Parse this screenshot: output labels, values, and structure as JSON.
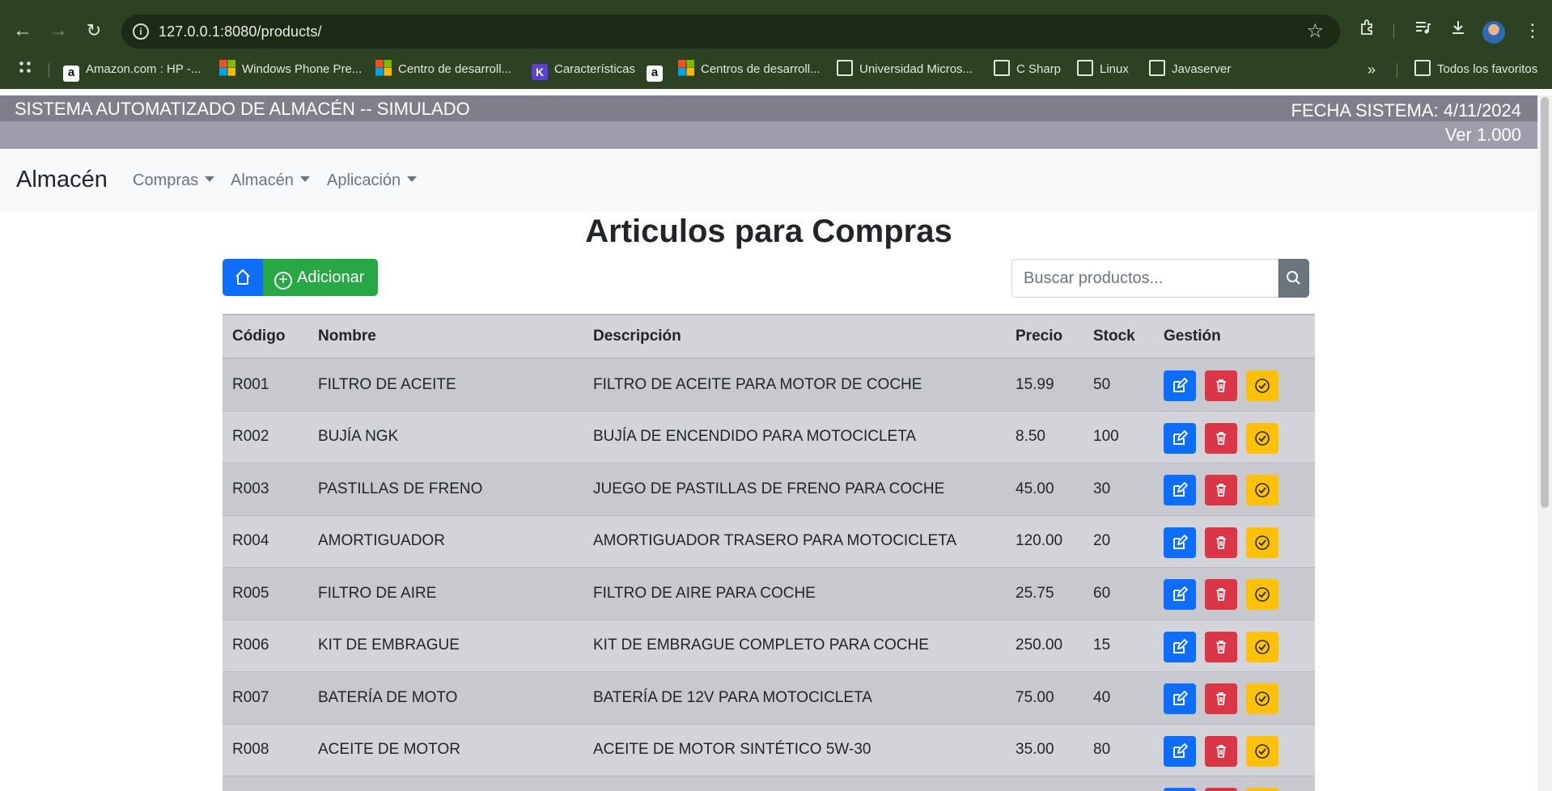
{
  "browser": {
    "url": "127.0.0.1:8080/products/",
    "bookmarks": [
      {
        "label": "Amazon.com : HP -...",
        "icon": "amazon-icon"
      },
      {
        "label": "Windows Phone Pre...",
        "icon": "microsoft-icon"
      },
      {
        "label": "Centro de desarroll...",
        "icon": "microsoft-icon"
      },
      {
        "label": "Características",
        "icon": "k-icon"
      },
      {
        "label": "",
        "icon": "amazon-icon"
      },
      {
        "label": "Centros de desarroll...",
        "icon": "microsoft-icon"
      },
      {
        "label": "Universidad Micros...",
        "icon": "folder-icon"
      },
      {
        "label": "C Sharp",
        "icon": "folder-icon"
      },
      {
        "label": "Linux",
        "icon": "folder-icon"
      },
      {
        "label": "Javaserver",
        "icon": "folder-icon"
      }
    ],
    "overflow_label": "»",
    "all_bookmarks": "Todos los favoritos"
  },
  "system": {
    "title": "SISTEMA AUTOMATIZADO DE ALMACÉN -- SIMULADO",
    "date": "FECHA SISTEMA: 4/11/2024",
    "version": "Ver 1.000"
  },
  "nav": {
    "brand": "Almacén",
    "menus": [
      "Compras",
      "Almacén",
      "Aplicación"
    ]
  },
  "page": {
    "title": "Articulos para Compras",
    "add_label": "Adicionar",
    "search_placeholder": "Buscar productos..."
  },
  "table": {
    "headers": [
      "Código",
      "Nombre",
      "Descripción",
      "Precio",
      "Stock",
      "Gestión"
    ],
    "rows": [
      [
        "R001",
        "FILTRO DE ACEITE",
        "FILTRO DE ACEITE PARA MOTOR DE COCHE",
        "15.99",
        "50"
      ],
      [
        "R002",
        "BUJÍA NGK",
        "BUJÍA DE ENCENDIDO PARA MOTOCICLETA",
        "8.50",
        "100"
      ],
      [
        "R003",
        "PASTILLAS DE FRENO",
        "JUEGO DE PASTILLAS DE FRENO PARA COCHE",
        "45.00",
        "30"
      ],
      [
        "R004",
        "AMORTIGUADOR",
        "AMORTIGUADOR TRASERO PARA MOTOCICLETA",
        "120.00",
        "20"
      ],
      [
        "R005",
        "FILTRO DE AIRE",
        "FILTRO DE AIRE PARA COCHE",
        "25.75",
        "60"
      ],
      [
        "R006",
        "KIT DE EMBRAGUE",
        "KIT DE EMBRAGUE COMPLETO PARA COCHE",
        "250.00",
        "15"
      ],
      [
        "R007",
        "BATERÍA DE MOTO",
        "BATERÍA DE 12V PARA MOTOCICLETA",
        "75.00",
        "40"
      ],
      [
        "R008",
        "ACEITE DE MOTOR",
        "ACEITE DE MOTOR SINTÉTICO 5W-30",
        "35.00",
        "80"
      ],
      [
        "",
        "",
        "",
        "",
        ""
      ]
    ]
  },
  "colors": {
    "edit": "#0d6efd",
    "delete": "#dc3545",
    "confirm": "#ffc107",
    "add": "#28a745"
  }
}
